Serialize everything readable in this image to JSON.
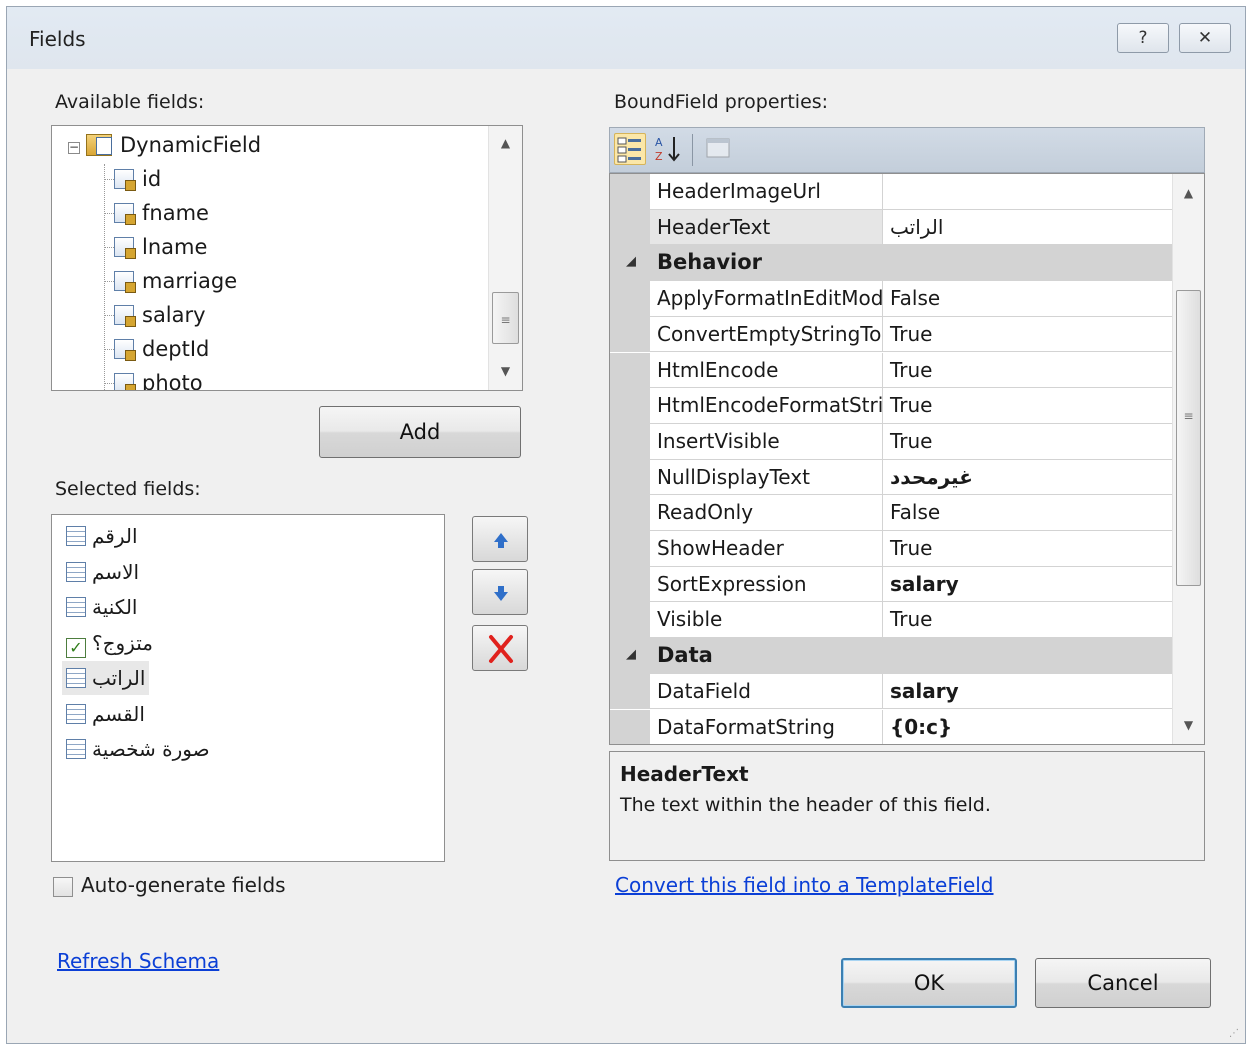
{
  "window": {
    "title": "Fields",
    "help_glyph": "?",
    "close_glyph": "✕"
  },
  "available": {
    "label": "Available fields:",
    "root": "DynamicField",
    "items": [
      "id",
      "fname",
      "lname",
      "marriage",
      "salary",
      "deptId",
      "photo"
    ],
    "add_label": "Add"
  },
  "selected": {
    "label": "Selected fields:",
    "items": [
      {
        "text": "الرقم",
        "icon": "list-field-icon"
      },
      {
        "text": "الاسم",
        "icon": "list-field-icon"
      },
      {
        "text": "الكنية",
        "icon": "list-field-icon"
      },
      {
        "text": "متزوج؟",
        "icon": "checkbox-field-icon"
      },
      {
        "text": "الراتب",
        "icon": "list-field-icon"
      },
      {
        "text": "القسم",
        "icon": "list-field-icon"
      },
      {
        "text": "صورة شخصية",
        "icon": "list-field-icon"
      }
    ],
    "selected_index": 4
  },
  "auto_generate": {
    "label": "Auto-generate fields",
    "checked": false
  },
  "refresh_link": "Refresh Schema",
  "properties": {
    "label": "BoundField properties:",
    "rows": [
      {
        "name": "HeaderImageUrl",
        "value": ""
      },
      {
        "name": "HeaderText",
        "value": "الراتب",
        "selected": true
      },
      {
        "category": "Behavior"
      },
      {
        "name": "ApplyFormatInEditMode",
        "value": "False"
      },
      {
        "name": "ConvertEmptyStringToNull",
        "value": "True"
      },
      {
        "name": "HtmlEncode",
        "value": "True"
      },
      {
        "name": "HtmlEncodeFormatString",
        "value": "True"
      },
      {
        "name": "InsertVisible",
        "value": "True"
      },
      {
        "name": "NullDisplayText",
        "value": "غيرمحدد",
        "bold": true
      },
      {
        "name": "ReadOnly",
        "value": "False"
      },
      {
        "name": "ShowHeader",
        "value": "True"
      },
      {
        "name": "SortExpression",
        "value": "salary",
        "bold": true
      },
      {
        "name": "Visible",
        "value": "True"
      },
      {
        "category": "Data"
      },
      {
        "name": "DataField",
        "value": "salary",
        "bold": true
      },
      {
        "name": "DataFormatString",
        "value": "{0:c}",
        "bold": true
      }
    ],
    "desc_title": "HeaderText",
    "desc_text": "The text within the header of this field.",
    "convert_link": "Convert this field into a TemplateField"
  },
  "buttons": {
    "ok": "OK",
    "cancel": "Cancel"
  }
}
